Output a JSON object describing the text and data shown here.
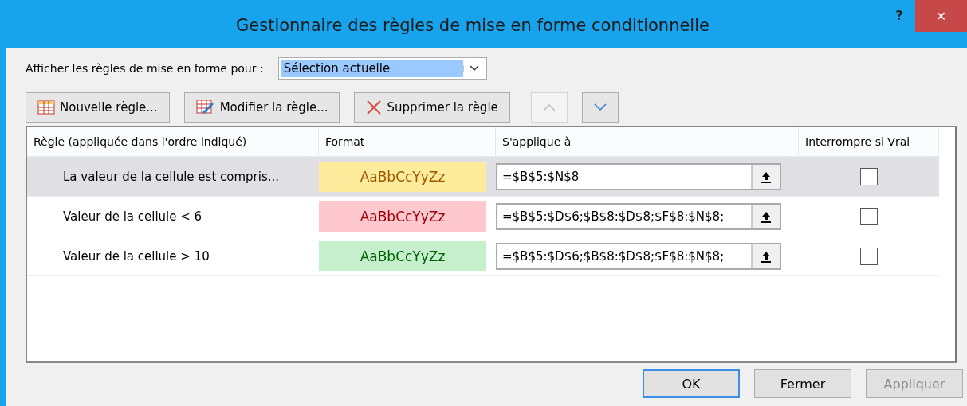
{
  "window": {
    "title": "Gestionnaire des règles de mise en forme conditionnelle",
    "help": "?",
    "close": "✕"
  },
  "show_rules_for": {
    "label": "Afficher les règles de mise en forme pour :",
    "value": "Sélection actuelle"
  },
  "toolbar": [
    {
      "kind": "new",
      "label": "Nouvelle règle..."
    },
    {
      "kind": "edit",
      "label": "Modifier la règle..."
    },
    {
      "kind": "delete",
      "label": "Supprimer la règle"
    },
    {
      "kind": "up",
      "disabled": true
    },
    {
      "kind": "down",
      "disabled": false
    }
  ],
  "table": {
    "columns": [
      "Règle (appliquée dans l'ordre indiqué)",
      "Format",
      "S'applique à",
      "Interrompre si Vrai"
    ],
    "rows": [
      {
        "rule": "La valeur de la cellule est compris...",
        "format": "AaBbCcYyZz",
        "kind": "neutral",
        "color": "#ffeb9c",
        "applies_to": "=$B$5:$N$8",
        "stop_if_true": false,
        "selected": true
      },
      {
        "rule": "Valeur de la cellule < 6",
        "format": "AaBbCcYyZz",
        "kind": "bad",
        "color": "#ffc7ce",
        "applies_to": "=$B$5:$D$6;$B$8:$D$8;$F$8:$N$8;",
        "stop_if_true": false,
        "selected": false
      },
      {
        "rule": "Valeur de la cellule > 10",
        "format": "AaBbCcYyZz",
        "kind": "good",
        "color": "#c6efce",
        "applies_to": "=$B$5:$D$6;$B$8:$D$8;$F$8:$N$8;",
        "stop_if_true": false,
        "selected": false
      }
    ]
  },
  "buttons": [
    {
      "label": "OK",
      "default": true,
      "disabled": false
    },
    {
      "label": "Fermer",
      "default": false,
      "disabled": false
    },
    {
      "label": "Appliquer",
      "default": false,
      "disabled": true
    }
  ]
}
